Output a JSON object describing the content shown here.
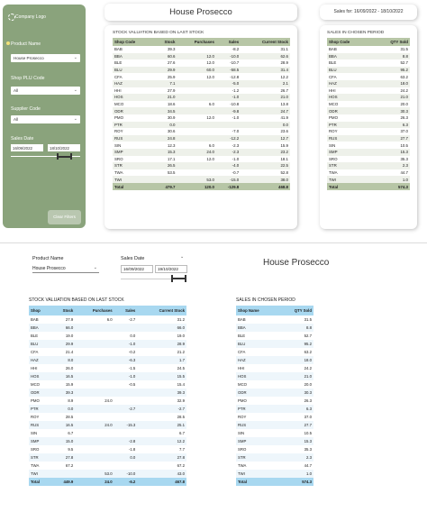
{
  "sidebar": {
    "logo_text": "Company Logo",
    "product_label": "Product Name",
    "product_value": "House Prosecco",
    "shop_label": "Shop PLU Code",
    "shop_value": "All",
    "supplier_label": "Supplier Code",
    "supplier_value": "All",
    "sales_date_label": "Sales Date",
    "date_from": "16/09/2022",
    "date_to": "18/10/2022",
    "clear_button": "Clear Filters"
  },
  "top": {
    "title": "House Prosecco",
    "sales_for": "Sales for:  16/09/2022 - 18/10/2022",
    "valuation_title": "STOCK VALUATION BASED ON LAST STOCK",
    "valuation_headers": [
      "Shop Code",
      "Stock",
      "Purchases",
      "Sales",
      "Current Stock"
    ],
    "valuation_rows": [
      [
        "BAB",
        "39.3",
        "",
        "-8.2",
        "31.1"
      ],
      [
        "BBA",
        "60.6",
        "12.0",
        "-10.0",
        "62.6"
      ],
      [
        "BLE",
        "27.6",
        "12.0",
        "-10.7",
        "28.9"
      ],
      [
        "BLU",
        "29.9",
        "60.0",
        "-58.5",
        "31.4"
      ],
      [
        "CFA",
        "25.9",
        "12.0",
        "-12.8",
        "12.2"
      ],
      [
        "HAZ",
        "7.1",
        "",
        "-5.0",
        "2.1"
      ],
      [
        "HHI",
        "27.9",
        "",
        "-1.2",
        "26.7"
      ],
      [
        "HOS",
        "21.0",
        "",
        "-1.0",
        "21.0"
      ],
      [
        "MCO",
        "18.6",
        "6.0",
        "-10.8",
        "13.8"
      ],
      [
        "ODR",
        "34.5",
        "",
        "-9.8",
        "24.7"
      ],
      [
        "PMO",
        "30.9",
        "12.0",
        "-1.0",
        "41.9"
      ],
      [
        "PTR",
        "0.0",
        "",
        "",
        "0.0"
      ],
      [
        "ROY",
        "30.6",
        "",
        "-7.0",
        "23.6"
      ],
      [
        "RUS",
        "24.8",
        "",
        "-12.2",
        "12.7"
      ],
      [
        "SIN",
        "12.3",
        "6.0",
        "-2.3",
        "15.9"
      ],
      [
        "SMP",
        "15.3",
        "24.0",
        "-2.3",
        "23.2"
      ],
      [
        "SRO",
        "17.1",
        "12.0",
        "-1.0",
        "18.1"
      ],
      [
        "STR",
        "26.5",
        "",
        "-4.0",
        "22.5"
      ],
      [
        "TWA",
        "53.5",
        "",
        "-0.7",
        "52.8"
      ],
      [
        "TWI",
        "",
        "53.0",
        "-15.0",
        "38.0"
      ]
    ],
    "valuation_total": [
      "Total",
      "479.7",
      "120.0",
      "-129.8",
      "468.8"
    ],
    "sales_title": "SALES IN CHOSEN PERIOD",
    "sales_headers": [
      "Shop Code",
      "QTY Sold"
    ],
    "sales_rows": [
      [
        "BAB",
        "31.5"
      ],
      [
        "BBA",
        "8.8"
      ],
      [
        "BLE",
        "52.7"
      ],
      [
        "BLU",
        "95.2"
      ],
      [
        "CFA",
        "63.2"
      ],
      [
        "HAZ",
        "18.0"
      ],
      [
        "HHI",
        "24.2"
      ],
      [
        "HOS",
        "21.0"
      ],
      [
        "MCO",
        "20.0"
      ],
      [
        "ODR",
        "30.3"
      ],
      [
        "PMO",
        "26.3"
      ],
      [
        "PTR",
        "6.3"
      ],
      [
        "ROY",
        "37.0"
      ],
      [
        "RUS",
        "27.7"
      ],
      [
        "SIN",
        "10.5"
      ],
      [
        "SMP",
        "15.3"
      ],
      [
        "SRO",
        "35.3"
      ],
      [
        "STR",
        "2.3"
      ],
      [
        "TWA",
        "44.7"
      ],
      [
        "TWI",
        "1.0"
      ]
    ],
    "sales_total": [
      "Total",
      "574.3"
    ]
  },
  "lower": {
    "product_label": "Product Name",
    "product_value": "House Prosecco",
    "sales_date_label": "Sales Date",
    "date_from": "16/09/2022",
    "date_to": "19/10/2022",
    "title": "House Prosecco",
    "valuation_title": "STOCK VALUATION BASED ON LAST STOCK",
    "valuation_headers": [
      "Shop",
      "Stock",
      "Purchases",
      "Sales",
      "Current Stock"
    ],
    "valuation_rows": [
      [
        "BAB",
        "27.9",
        "6.0",
        "-2.7",
        "31.2"
      ],
      [
        "BBA",
        "66.0",
        "",
        "",
        "66.0"
      ],
      [
        "BLE",
        "19.0",
        "",
        "0.0",
        "19.0"
      ],
      [
        "BLU",
        "29.9",
        "",
        "-1.0",
        "28.9"
      ],
      [
        "CFA",
        "21.4",
        "",
        "-0.2",
        "21.2"
      ],
      [
        "HAZ",
        "8.0",
        "",
        "-6.3",
        "1.7"
      ],
      [
        "HHI",
        "26.0",
        "",
        "-1.5",
        "24.5"
      ],
      [
        "HOS",
        "16.5",
        "",
        "-1.0",
        "15.5"
      ],
      [
        "MCO",
        "15.9",
        "",
        "-0.5",
        "15.4"
      ],
      [
        "ODR",
        "39.3",
        "",
        "",
        "39.3"
      ],
      [
        "PMO",
        "8.9",
        "24.0",
        "",
        "32.9"
      ],
      [
        "PTR",
        "0.0",
        "",
        "-2.7",
        "-2.7"
      ],
      [
        "ROY",
        "28.5",
        "",
        "",
        "28.5"
      ],
      [
        "RUS",
        "16.5",
        "24.0",
        "-15.3",
        "25.1"
      ],
      [
        "SIN",
        "6.7",
        "",
        "",
        "6.7"
      ],
      [
        "SMP",
        "15.0",
        "",
        "-2.8",
        "12.2"
      ],
      [
        "SRO",
        "9.5",
        "",
        "-1.8",
        "7.7"
      ],
      [
        "STR",
        "27.8",
        "",
        "0.0",
        "27.8"
      ],
      [
        "TWA",
        "67.2",
        "",
        "",
        "67.2"
      ],
      [
        "TWI",
        "",
        "53.0",
        "-10.0",
        "43.0"
      ]
    ],
    "valuation_total": [
      "Total",
      "449.9",
      "24.0",
      "-6.2",
      "467.8"
    ],
    "sales_title": "SALES IN CHOSEN PERIOD",
    "sales_headers": [
      "Shop Name",
      "QTY Sold"
    ],
    "sales_rows": [
      [
        "BAB",
        "31.5"
      ],
      [
        "BBA",
        "8.8"
      ],
      [
        "BLE",
        "52.7"
      ],
      [
        "BLU",
        "95.2"
      ],
      [
        "CFA",
        "63.2"
      ],
      [
        "HAZ",
        "18.0"
      ],
      [
        "HHI",
        "24.2"
      ],
      [
        "HOS",
        "21.0"
      ],
      [
        "MCO",
        "20.0"
      ],
      [
        "ODR",
        "30.3"
      ],
      [
        "PMO",
        "26.3"
      ],
      [
        "PTR",
        "6.3"
      ],
      [
        "ROY",
        "37.0"
      ],
      [
        "RUS",
        "27.7"
      ],
      [
        "SIN",
        "10.5"
      ],
      [
        "SMP",
        "15.3"
      ],
      [
        "SRO",
        "35.3"
      ],
      [
        "STR",
        "2.3"
      ],
      [
        "TWA",
        "44.7"
      ],
      [
        "TWI",
        "1.0"
      ]
    ],
    "sales_total": [
      "Total",
      "574.3"
    ]
  },
  "colors": {
    "sidebar": "#8aa37c",
    "green_header": "#b7c6a6",
    "blue_header": "#a8d8f0"
  }
}
